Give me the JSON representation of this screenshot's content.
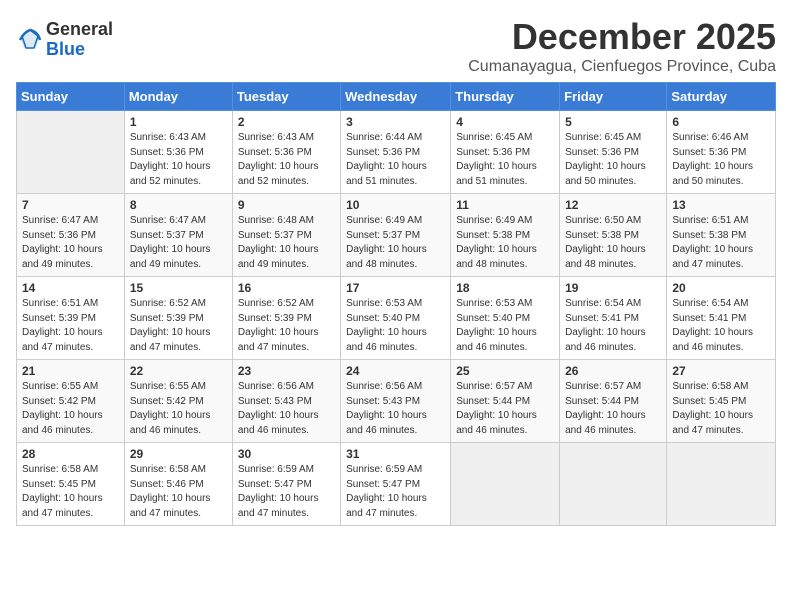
{
  "logo": {
    "general": "General",
    "blue": "Blue"
  },
  "title": "December 2025",
  "subtitle": "Cumanayagua, Cienfuegos Province, Cuba",
  "headers": [
    "Sunday",
    "Monday",
    "Tuesday",
    "Wednesday",
    "Thursday",
    "Friday",
    "Saturday"
  ],
  "weeks": [
    [
      {
        "day": "",
        "detail": ""
      },
      {
        "day": "1",
        "detail": "Sunrise: 6:43 AM\nSunset: 5:36 PM\nDaylight: 10 hours\nand 52 minutes."
      },
      {
        "day": "2",
        "detail": "Sunrise: 6:43 AM\nSunset: 5:36 PM\nDaylight: 10 hours\nand 52 minutes."
      },
      {
        "day": "3",
        "detail": "Sunrise: 6:44 AM\nSunset: 5:36 PM\nDaylight: 10 hours\nand 51 minutes."
      },
      {
        "day": "4",
        "detail": "Sunrise: 6:45 AM\nSunset: 5:36 PM\nDaylight: 10 hours\nand 51 minutes."
      },
      {
        "day": "5",
        "detail": "Sunrise: 6:45 AM\nSunset: 5:36 PM\nDaylight: 10 hours\nand 50 minutes."
      },
      {
        "day": "6",
        "detail": "Sunrise: 6:46 AM\nSunset: 5:36 PM\nDaylight: 10 hours\nand 50 minutes."
      }
    ],
    [
      {
        "day": "7",
        "detail": "Sunrise: 6:47 AM\nSunset: 5:36 PM\nDaylight: 10 hours\nand 49 minutes."
      },
      {
        "day": "8",
        "detail": "Sunrise: 6:47 AM\nSunset: 5:37 PM\nDaylight: 10 hours\nand 49 minutes."
      },
      {
        "day": "9",
        "detail": "Sunrise: 6:48 AM\nSunset: 5:37 PM\nDaylight: 10 hours\nand 49 minutes."
      },
      {
        "day": "10",
        "detail": "Sunrise: 6:49 AM\nSunset: 5:37 PM\nDaylight: 10 hours\nand 48 minutes."
      },
      {
        "day": "11",
        "detail": "Sunrise: 6:49 AM\nSunset: 5:38 PM\nDaylight: 10 hours\nand 48 minutes."
      },
      {
        "day": "12",
        "detail": "Sunrise: 6:50 AM\nSunset: 5:38 PM\nDaylight: 10 hours\nand 48 minutes."
      },
      {
        "day": "13",
        "detail": "Sunrise: 6:51 AM\nSunset: 5:38 PM\nDaylight: 10 hours\nand 47 minutes."
      }
    ],
    [
      {
        "day": "14",
        "detail": "Sunrise: 6:51 AM\nSunset: 5:39 PM\nDaylight: 10 hours\nand 47 minutes."
      },
      {
        "day": "15",
        "detail": "Sunrise: 6:52 AM\nSunset: 5:39 PM\nDaylight: 10 hours\nand 47 minutes."
      },
      {
        "day": "16",
        "detail": "Sunrise: 6:52 AM\nSunset: 5:39 PM\nDaylight: 10 hours\nand 47 minutes."
      },
      {
        "day": "17",
        "detail": "Sunrise: 6:53 AM\nSunset: 5:40 PM\nDaylight: 10 hours\nand 46 minutes."
      },
      {
        "day": "18",
        "detail": "Sunrise: 6:53 AM\nSunset: 5:40 PM\nDaylight: 10 hours\nand 46 minutes."
      },
      {
        "day": "19",
        "detail": "Sunrise: 6:54 AM\nSunset: 5:41 PM\nDaylight: 10 hours\nand 46 minutes."
      },
      {
        "day": "20",
        "detail": "Sunrise: 6:54 AM\nSunset: 5:41 PM\nDaylight: 10 hours\nand 46 minutes."
      }
    ],
    [
      {
        "day": "21",
        "detail": "Sunrise: 6:55 AM\nSunset: 5:42 PM\nDaylight: 10 hours\nand 46 minutes."
      },
      {
        "day": "22",
        "detail": "Sunrise: 6:55 AM\nSunset: 5:42 PM\nDaylight: 10 hours\nand 46 minutes."
      },
      {
        "day": "23",
        "detail": "Sunrise: 6:56 AM\nSunset: 5:43 PM\nDaylight: 10 hours\nand 46 minutes."
      },
      {
        "day": "24",
        "detail": "Sunrise: 6:56 AM\nSunset: 5:43 PM\nDaylight: 10 hours\nand 46 minutes."
      },
      {
        "day": "25",
        "detail": "Sunrise: 6:57 AM\nSunset: 5:44 PM\nDaylight: 10 hours\nand 46 minutes."
      },
      {
        "day": "26",
        "detail": "Sunrise: 6:57 AM\nSunset: 5:44 PM\nDaylight: 10 hours\nand 46 minutes."
      },
      {
        "day": "27",
        "detail": "Sunrise: 6:58 AM\nSunset: 5:45 PM\nDaylight: 10 hours\nand 47 minutes."
      }
    ],
    [
      {
        "day": "28",
        "detail": "Sunrise: 6:58 AM\nSunset: 5:45 PM\nDaylight: 10 hours\nand 47 minutes."
      },
      {
        "day": "29",
        "detail": "Sunrise: 6:58 AM\nSunset: 5:46 PM\nDaylight: 10 hours\nand 47 minutes."
      },
      {
        "day": "30",
        "detail": "Sunrise: 6:59 AM\nSunset: 5:47 PM\nDaylight: 10 hours\nand 47 minutes."
      },
      {
        "day": "31",
        "detail": "Sunrise: 6:59 AM\nSunset: 5:47 PM\nDaylight: 10 hours\nand 47 minutes."
      },
      {
        "day": "",
        "detail": ""
      },
      {
        "day": "",
        "detail": ""
      },
      {
        "day": "",
        "detail": ""
      }
    ]
  ]
}
